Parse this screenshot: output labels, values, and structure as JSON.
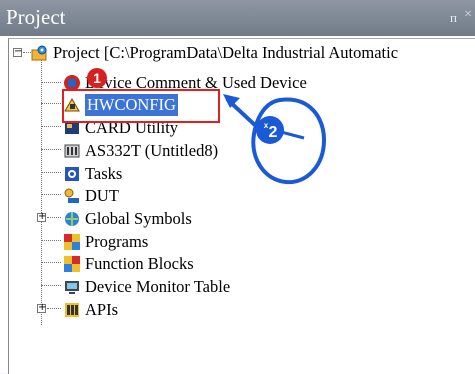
{
  "panel": {
    "title": "Project",
    "pin_glyph": "ᴨ",
    "close_glyph": "×"
  },
  "tree": {
    "root_label": "Project [C:\\ProgramData\\Delta Industrial Automatic",
    "items": [
      {
        "label": "Device Comment & Used Device",
        "icon": "device-comment-icon"
      },
      {
        "label": "HWCONFIG",
        "icon": "hwconfig-icon",
        "selected": true
      },
      {
        "label": "CARD Utility",
        "icon": "card-utility-icon"
      },
      {
        "label": "AS332T  (Untitled8)",
        "icon": "plc-icon"
      },
      {
        "label": "Tasks",
        "icon": "tasks-icon"
      },
      {
        "label": "DUT",
        "icon": "dut-icon"
      },
      {
        "label": "Global Symbols",
        "icon": "global-symbols-icon",
        "expandable": true
      },
      {
        "label": "Programs",
        "icon": "programs-icon"
      },
      {
        "label": "Function Blocks",
        "icon": "function-blocks-icon"
      },
      {
        "label": "Device Monitor Table",
        "icon": "device-monitor-icon"
      },
      {
        "label": "APIs",
        "icon": "apis-icon",
        "expandable": true
      }
    ]
  },
  "annotation": {
    "step_label": "2",
    "click_multiplier": "x2",
    "step_badge_number": "1"
  },
  "colors": {
    "highlight": "#e02020",
    "selection": "#3b73d6",
    "annotation_blue": "#1a5ad6"
  }
}
